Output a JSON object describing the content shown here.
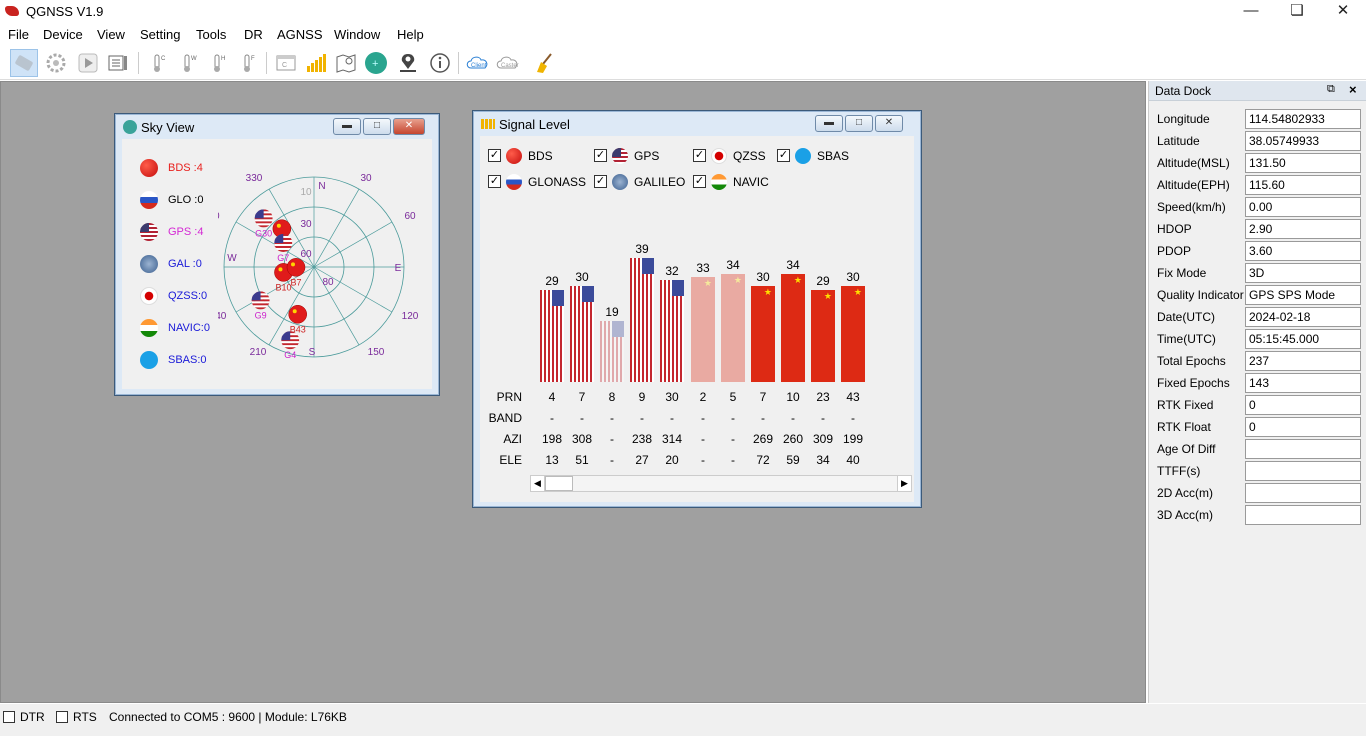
{
  "app": {
    "title": "QGNSS V1.9"
  },
  "menu": [
    "File",
    "Device",
    "View",
    "Setting",
    "Tools",
    "DR",
    "AGNSS",
    "Window",
    "Help"
  ],
  "toolbar": {
    "client_label": "Client",
    "caster_label": "Caster"
  },
  "sky_view": {
    "title": "Sky View",
    "legend": [
      {
        "label": "BDS :4",
        "color": "#e8211e",
        "flag": "cn"
      },
      {
        "label": "GLO :0",
        "color": "#000000",
        "flag": "ru"
      },
      {
        "label": "GPS :4",
        "color": "#d428d4",
        "flag": "us"
      },
      {
        "label": "GAL :0",
        "color": "#1a1ad8",
        "flag": "ga"
      },
      {
        "label": "QZSS:0",
        "color": "#1a1ad8",
        "flag": "jp"
      },
      {
        "label": "NAVIC:0",
        "color": "#1a1ad8",
        "flag": "in"
      },
      {
        "label": "SBAS:0",
        "color": "#1a1ad8",
        "flag": "sb"
      }
    ],
    "compass": {
      "N": "N",
      "E": "E",
      "S": "S",
      "W": "W"
    },
    "azimuth_labels": [
      "330",
      "30",
      "60",
      "120",
      "150",
      "210",
      "240",
      "00"
    ],
    "elevation_labels": [
      "10",
      "30",
      "60",
      "80"
    ],
    "satellites": [
      {
        "label": "B29",
        "type": "cn",
        "az": 320,
        "el": 40
      },
      {
        "label": "G30",
        "type": "us",
        "az": 314,
        "el": 20
      },
      {
        "label": "G7",
        "type": "us",
        "az": 308,
        "el": 51
      },
      {
        "label": "B10",
        "type": "cn",
        "az": 260,
        "el": 59
      },
      {
        "label": "B7",
        "type": "cn",
        "az": 269,
        "el": 72
      },
      {
        "label": "G9",
        "type": "us",
        "az": 238,
        "el": 27
      },
      {
        "label": "B43",
        "type": "cn",
        "az": 199,
        "el": 40
      },
      {
        "label": "G4",
        "type": "us",
        "az": 198,
        "el": 13
      }
    ]
  },
  "signal_level": {
    "title": "Signal Level",
    "filters": [
      {
        "label": "BDS",
        "flag": "cn",
        "checked": true
      },
      {
        "label": "GPS",
        "flag": "us",
        "checked": true
      },
      {
        "label": "QZSS",
        "flag": "jp",
        "checked": true
      },
      {
        "label": "SBAS",
        "flag": "sb",
        "checked": true
      },
      {
        "label": "GLONASS",
        "flag": "ru",
        "checked": true
      },
      {
        "label": "GALILEO",
        "flag": "ga",
        "checked": true
      },
      {
        "label": "NAVIC",
        "flag": "in",
        "checked": true
      }
    ],
    "row_labels": {
      "prn": "PRN",
      "band": "BAND",
      "azi": "AZI",
      "ele": "ELE"
    },
    "bars": [
      {
        "prn": "4",
        "value": 29,
        "type": "us",
        "faded": false,
        "band": "-",
        "azi": "198",
        "ele": "13"
      },
      {
        "prn": "7",
        "value": 30,
        "type": "us",
        "faded": false,
        "band": "-",
        "azi": "308",
        "ele": "51"
      },
      {
        "prn": "8",
        "value": 19,
        "type": "us",
        "faded": true,
        "band": "-",
        "azi": "-",
        "ele": "-"
      },
      {
        "prn": "9",
        "value": 39,
        "type": "us",
        "faded": false,
        "band": "-",
        "azi": "238",
        "ele": "27"
      },
      {
        "prn": "30",
        "value": 32,
        "type": "us",
        "faded": false,
        "band": "-",
        "azi": "314",
        "ele": "20"
      },
      {
        "prn": "2",
        "value": 33,
        "type": "cn",
        "faded": true,
        "band": "-",
        "azi": "-",
        "ele": "-"
      },
      {
        "prn": "5",
        "value": 34,
        "type": "cn",
        "faded": true,
        "band": "-",
        "azi": "-",
        "ele": "-"
      },
      {
        "prn": "7",
        "value": 30,
        "type": "cn",
        "faded": false,
        "band": "-",
        "azi": "269",
        "ele": "72"
      },
      {
        "prn": "10",
        "value": 34,
        "type": "cn",
        "faded": false,
        "band": "-",
        "azi": "260",
        "ele": "59"
      },
      {
        "prn": "23",
        "value": 29,
        "type": "cn",
        "faded": false,
        "band": "-",
        "azi": "309",
        "ele": "34"
      },
      {
        "prn": "43",
        "value": 30,
        "type": "cn",
        "faded": false,
        "band": "-",
        "azi": "199",
        "ele": "40"
      }
    ]
  },
  "data_dock": {
    "title": "Data Dock",
    "rows": [
      {
        "label": "Longitude",
        "value": "114.54802933"
      },
      {
        "label": "Latitude",
        "value": "38.05749933"
      },
      {
        "label": "Altitude(MSL)",
        "value": "131.50"
      },
      {
        "label": "Altitude(EPH)",
        "value": "115.60"
      },
      {
        "label": "Speed(km/h)",
        "value": "0.00"
      },
      {
        "label": "HDOP",
        "value": "2.90"
      },
      {
        "label": "PDOP",
        "value": "3.60"
      },
      {
        "label": "Fix Mode",
        "value": "3D"
      },
      {
        "label": "Quality Indicator",
        "value": "GPS SPS Mode"
      },
      {
        "label": "Date(UTC)",
        "value": "2024-02-18"
      },
      {
        "label": "Time(UTC)",
        "value": "05:15:45.000"
      },
      {
        "label": "Total Epochs",
        "value": "237"
      },
      {
        "label": "Fixed Epochs",
        "value": "143"
      },
      {
        "label": "RTK Fixed",
        "value": "0"
      },
      {
        "label": "RTK Float",
        "value": "0"
      },
      {
        "label": "Age Of Diff",
        "value": ""
      },
      {
        "label": "TTFF(s)",
        "value": ""
      },
      {
        "label": "2D Acc(m)",
        "value": ""
      },
      {
        "label": "3D Acc(m)",
        "value": ""
      }
    ]
  },
  "status": {
    "dtr": "DTR",
    "rts": "RTS",
    "message": "Connected to COM5 : 9600 | Module: L76KB"
  }
}
